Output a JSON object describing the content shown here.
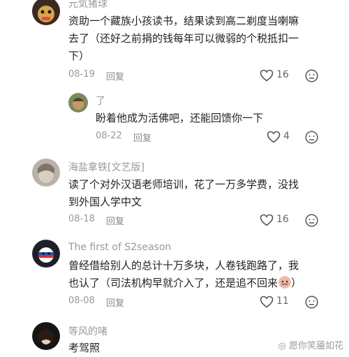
{
  "comments": [
    {
      "username": "元気猪球",
      "text_lines": [
        "资助一个藏族小孩读书，结果读到高二剃度当喇嘛",
        "去了（还好之前捐的钱每年可以微弱的个税抵扣一",
        "下）"
      ],
      "date": "08-19",
      "reply_label": "回复",
      "likes": "16"
    },
    {
      "username": "了",
      "text_lines": [
        "盼着他成为活佛吧，还能回馈你一下"
      ],
      "date": "08-22",
      "reply_label": "回复",
      "likes": "4"
    },
    {
      "username": "海盐拿铁[文艺版]",
      "text_lines": [
        "读了个对外汉语老师培训，花了一万多学费，没找",
        "到外国人学中文"
      ],
      "date": "08-18",
      "reply_label": "回复",
      "likes": "16"
    },
    {
      "username": "The first of S2season",
      "text_lines": [
        "曾经借给别人的总计十万多块，人卷钱跑路了，我",
        "也认了（司法机构早就介入了，还是追不回来"
      ],
      "text_suffix": "）",
      "date": "08-08",
      "reply_label": "回复",
      "likes": "11"
    },
    {
      "username": "等风的啫",
      "text_lines": [
        "考驾照"
      ]
    }
  ],
  "watermark": "愿你笑靥如花",
  "colors": {
    "meta": "#999999",
    "text": "#222222",
    "icon": "#555555"
  },
  "icons": [
    "heart-outline-icon",
    "dislike-face-icon",
    "crying-emoji-icon"
  ]
}
